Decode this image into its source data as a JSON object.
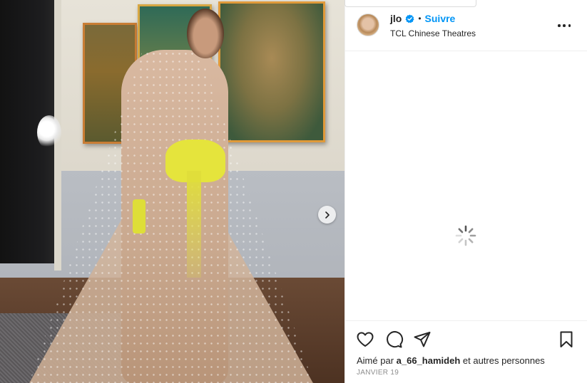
{
  "post": {
    "username": "jlo",
    "dot": "•",
    "follow_label": "Suivre",
    "location": "TCL Chinese Theatres"
  },
  "likes": {
    "prefix": "Aimé par",
    "user": "a_66_hamideh",
    "suffix": "et autres personnes"
  },
  "date": "JANVIER 19",
  "icons": {
    "verified": "verified-badge-icon",
    "more": "more-options-icon",
    "like": "heart-icon",
    "comment": "comment-icon",
    "share": "share-icon",
    "save": "bookmark-icon",
    "next": "chevron-right-icon",
    "loading": "spinner-icon"
  },
  "colors": {
    "accent": "#0095f6",
    "text": "#262626",
    "muted": "#8e8e8e"
  }
}
